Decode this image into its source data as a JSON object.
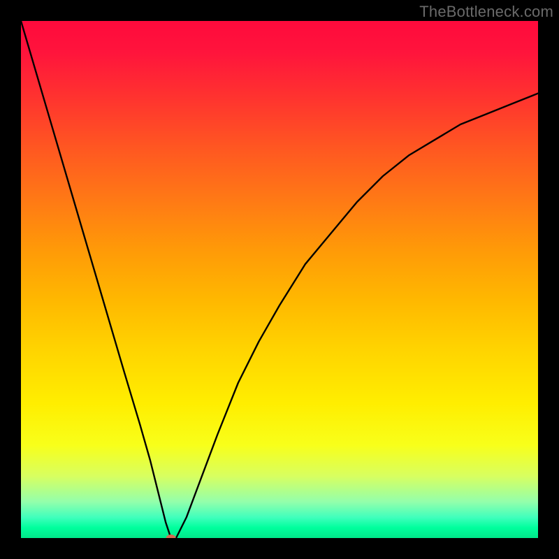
{
  "watermark": "TheBottleneck.com",
  "chart_data": {
    "type": "line",
    "title": "",
    "xlabel": "",
    "ylabel": "",
    "xlim": [
      0,
      100
    ],
    "ylim": [
      0,
      100
    ],
    "grid": false,
    "series": [
      {
        "name": "bottleneck-curve",
        "x": [
          0,
          5,
          10,
          15,
          20,
          23,
          25,
          26,
          27,
          28,
          29,
          30,
          32,
          35,
          38,
          42,
          46,
          50,
          55,
          60,
          65,
          70,
          75,
          80,
          85,
          90,
          95,
          100
        ],
        "values": [
          100,
          83,
          66,
          49,
          32,
          22,
          15,
          11,
          7,
          3,
          0,
          0,
          4,
          12,
          20,
          30,
          38,
          45,
          53,
          59,
          65,
          70,
          74,
          77,
          80,
          82,
          84,
          86
        ]
      }
    ],
    "marker": {
      "x": 29,
      "y": 0,
      "color": "#d76a52"
    },
    "gradient_stops": [
      {
        "pos": 0,
        "color": "#ff0a3c"
      },
      {
        "pos": 6,
        "color": "#ff143c"
      },
      {
        "pos": 14,
        "color": "#ff3030"
      },
      {
        "pos": 24,
        "color": "#ff5522"
      },
      {
        "pos": 34,
        "color": "#ff7716"
      },
      {
        "pos": 44,
        "color": "#ff9908"
      },
      {
        "pos": 54,
        "color": "#ffb800"
      },
      {
        "pos": 64,
        "color": "#ffd500"
      },
      {
        "pos": 74,
        "color": "#ffee00"
      },
      {
        "pos": 82,
        "color": "#f8ff1a"
      },
      {
        "pos": 88,
        "color": "#d8ff60"
      },
      {
        "pos": 93,
        "color": "#93ffab"
      },
      {
        "pos": 96,
        "color": "#40ffbc"
      },
      {
        "pos": 98,
        "color": "#00ff9d"
      },
      {
        "pos": 100,
        "color": "#00e88a"
      }
    ]
  }
}
